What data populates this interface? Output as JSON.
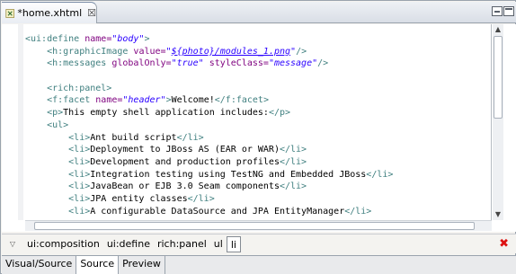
{
  "editor_tab": {
    "label": "*home.xhtml",
    "close_glyph": "☒"
  },
  "code_lines": [
    [
      {
        "c": "t",
        "s": "<ui:define "
      },
      {
        "c": "a",
        "s": "name="
      },
      {
        "c": "v",
        "s": "\"body\""
      },
      {
        "c": "t",
        "s": ">"
      }
    ],
    [
      {
        "c": "t",
        "s": "    <h:graphicImage "
      },
      {
        "c": "a",
        "s": "value="
      },
      {
        "c": "v",
        "s": "\""
      },
      {
        "c": "link",
        "s": "${photo}/modules_1.png"
      },
      {
        "c": "v",
        "s": "\""
      },
      {
        "c": "t",
        "s": "/>"
      }
    ],
    [
      {
        "c": "t",
        "s": "    <h:messages "
      },
      {
        "c": "a",
        "s": "globalOnly="
      },
      {
        "c": "v",
        "s": "\"true\""
      },
      {
        "c": "a",
        "s": " styleClass="
      },
      {
        "c": "v",
        "s": "\"message\""
      },
      {
        "c": "t",
        "s": "/>"
      }
    ],
    [],
    [
      {
        "c": "t",
        "s": "    <rich:panel>"
      }
    ],
    [
      {
        "c": "t",
        "s": "    <f:facet "
      },
      {
        "c": "a",
        "s": "name="
      },
      {
        "c": "v",
        "s": "\"header\""
      },
      {
        "c": "t",
        "s": ">"
      },
      {
        "c": "tx",
        "s": "Welcome!"
      },
      {
        "c": "t",
        "s": "</f:facet>"
      }
    ],
    [
      {
        "c": "t",
        "s": "    <p>"
      },
      {
        "c": "tx",
        "s": "This empty shell application includes:"
      },
      {
        "c": "t",
        "s": "</p>"
      }
    ],
    [
      {
        "c": "t",
        "s": "    <ul>"
      }
    ],
    [
      {
        "c": "t",
        "s": "        <li>"
      },
      {
        "c": "tx",
        "s": "Ant build script"
      },
      {
        "c": "t",
        "s": "</li>"
      }
    ],
    [
      {
        "c": "t",
        "s": "        <li>"
      },
      {
        "c": "tx",
        "s": "Deployment to JBoss AS (EAR or WAR)"
      },
      {
        "c": "t",
        "s": "</li>"
      }
    ],
    [
      {
        "c": "t",
        "s": "        <li>"
      },
      {
        "c": "tx",
        "s": "Development and production profiles"
      },
      {
        "c": "t",
        "s": "</li>"
      }
    ],
    [
      {
        "c": "t",
        "s": "        <li>"
      },
      {
        "c": "tx",
        "s": "Integration testing using TestNG and Embedded JBoss"
      },
      {
        "c": "t",
        "s": "</li>"
      }
    ],
    [
      {
        "c": "t",
        "s": "        <li>"
      },
      {
        "c": "tx",
        "s": "JavaBean or EJB 3.0 Seam components"
      },
      {
        "c": "t",
        "s": "</li>"
      }
    ],
    [
      {
        "c": "t",
        "s": "        <li>"
      },
      {
        "c": "tx",
        "s": "JPA entity classes"
      },
      {
        "c": "t",
        "s": "</li>"
      }
    ],
    [
      {
        "c": "t",
        "s": "        <li>"
      },
      {
        "c": "tx",
        "s": "A configurable DataSource and JPA EntityManager"
      },
      {
        "c": "t",
        "s": "</li>"
      }
    ]
  ],
  "breadcrumb": [
    "ui:composition",
    "ui:define",
    "rich:panel",
    "ul",
    "li"
  ],
  "breadcrumb_selected_index": 4,
  "page_tabs": [
    "Visual/Source",
    "Source",
    "Preview"
  ],
  "page_tabs_active_index": 1,
  "colors": {
    "tag": "#3f7f7f",
    "attribute": "#7f007f",
    "value": "#2a00ff",
    "clear_icon": "#d11111"
  }
}
